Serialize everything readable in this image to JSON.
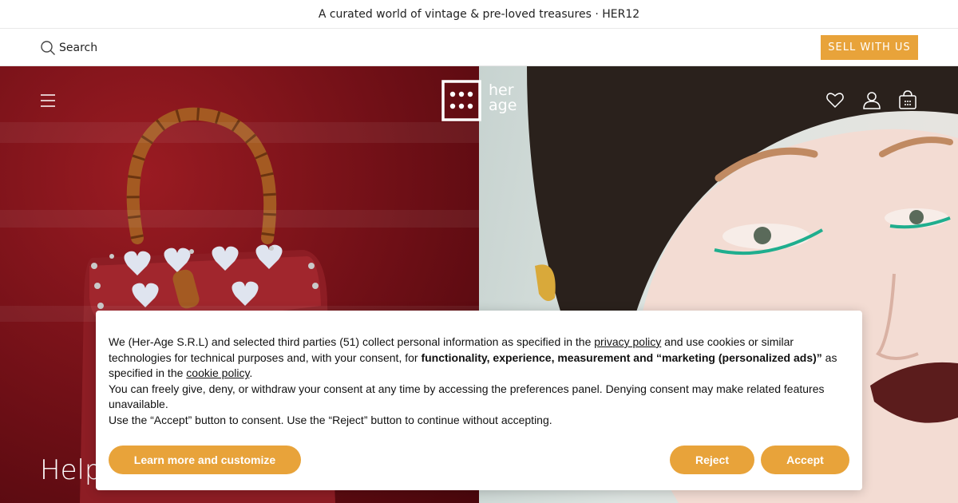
{
  "announcement": "A curated world of vintage & pre-loved treasures · HER12",
  "search": {
    "placeholder": "Search"
  },
  "header": {
    "sell_label": "SELL WITH US",
    "logo_text_1": "her",
    "logo_text_2": "age"
  },
  "hero": {
    "headline": "Help"
  },
  "cookie_banner": {
    "p1_a": "We (Her-Age S.R.L) and selected third parties (51) collect personal information as specified in the ",
    "privacy_link": "privacy policy",
    "p1_b": " and use cookies or similar technologies for technical purposes and, with your consent, for ",
    "p1_bold": "functionality, experience, measurement and “marketing (personalized ads)”",
    "p1_c": " as specified in the ",
    "cookie_link": "cookie policy",
    "p1_d": ".",
    "p2": "You can freely give, deny, or withdraw your consent at any time by accessing the preferences panel. Denying consent may make related features unavailable.",
    "p3": "Use the “Accept” button to consent. Use the “Reject” button to continue without accepting.",
    "learn_label": "Learn more and customize",
    "reject_label": "Reject",
    "accept_label": "Accept"
  },
  "colors": {
    "accent": "#e8a33a",
    "hero_left": "#6e0f16",
    "hero_right": "#dde4e1"
  },
  "icons": [
    "search-icon",
    "menu-icon",
    "heart-icon",
    "user-icon",
    "bag-icon"
  ]
}
